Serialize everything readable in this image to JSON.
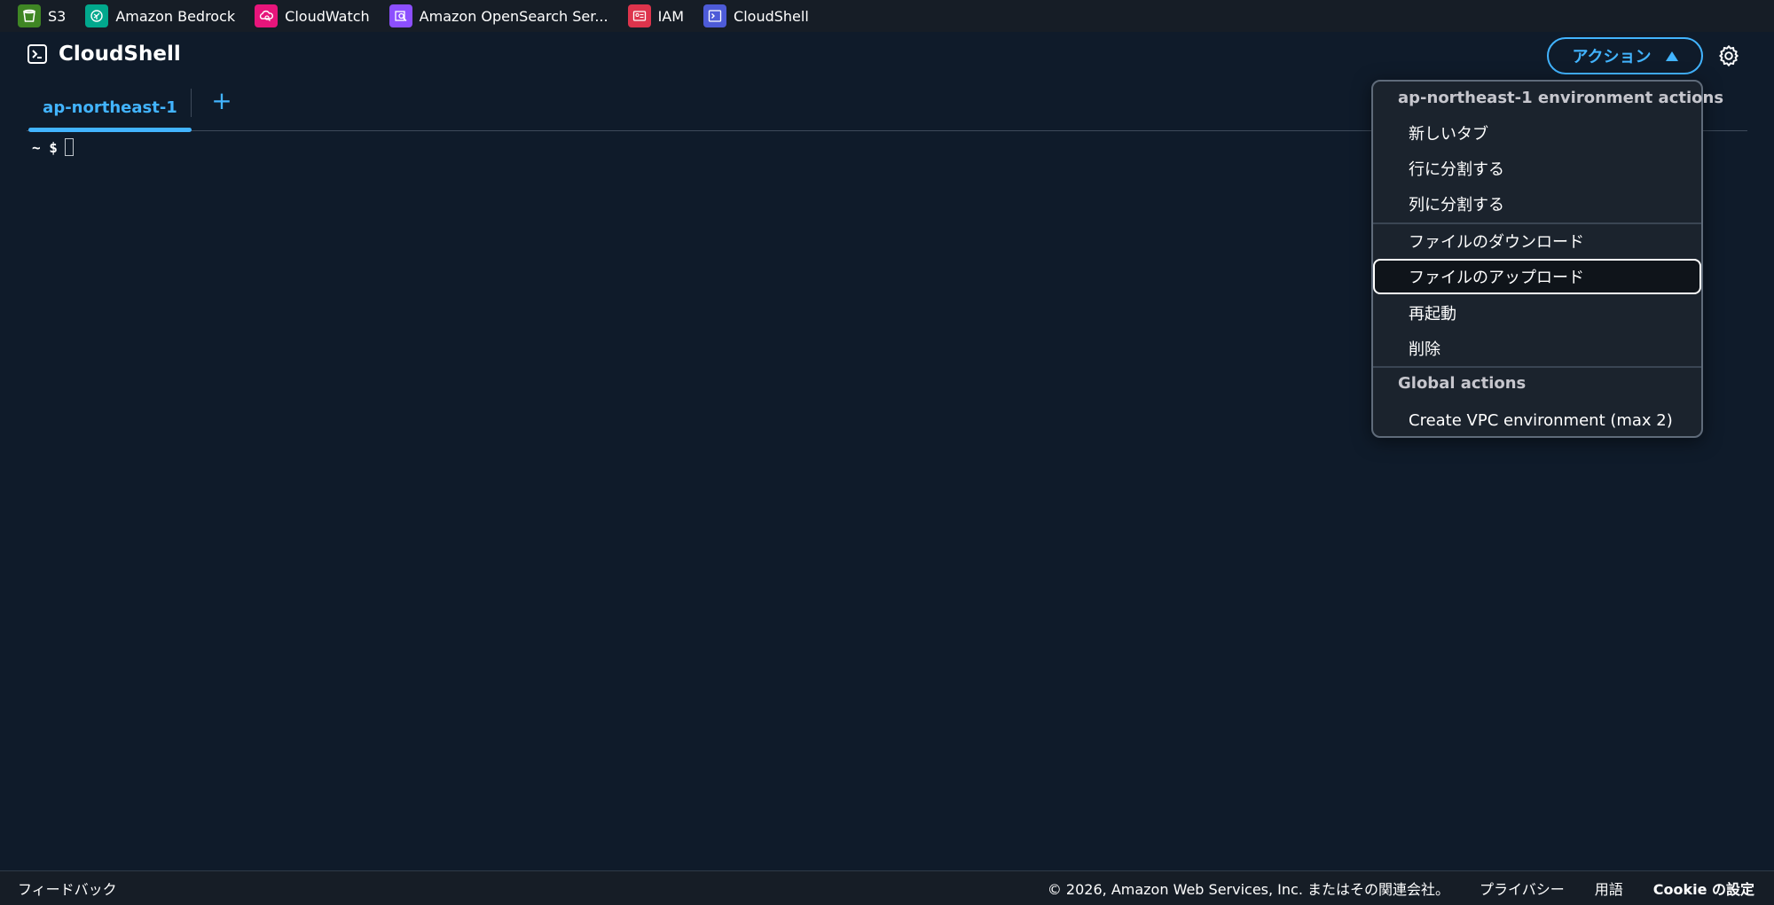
{
  "favorites": [
    {
      "label": "S3",
      "icon": "s3-bucket-icon",
      "color": "#3f8624"
    },
    {
      "label": "Amazon Bedrock",
      "icon": "bedrock-brain-icon",
      "color": "#01a88d"
    },
    {
      "label": "CloudWatch",
      "icon": "cloudwatch-icon",
      "color": "#e7157b"
    },
    {
      "label": "Amazon OpenSearch Ser...",
      "icon": "opensearch-icon",
      "color": "#8c4fff"
    },
    {
      "label": "IAM",
      "icon": "iam-id-card-icon",
      "color": "#dd344c"
    },
    {
      "label": "CloudShell",
      "icon": "cloudshell-terminal-icon",
      "color": "#4d5bd8"
    }
  ],
  "header": {
    "title": "CloudShell",
    "actions_label": "アクション",
    "accent_color": "#42b4ff"
  },
  "tabs": {
    "active": "ap-northeast-1",
    "add_label": "+"
  },
  "terminal": {
    "prompt": "~ $"
  },
  "menu": {
    "env_header": "ap-northeast-1 environment actions",
    "items_group1": [
      "新しいタブ",
      "行に分割する",
      "列に分割する"
    ],
    "items_group2": [
      "ファイルのダウンロード",
      "ファイルのアップロード"
    ],
    "items_group3": [
      "再起動",
      "削除"
    ],
    "global_header": "Global actions",
    "global_items": [
      "Create VPC environment (max 2)"
    ],
    "focused_item": "ファイルのアップロード"
  },
  "footer": {
    "feedback": "フィードバック",
    "copyright": "© 2026, Amazon Web Services, Inc. またはその関連会社。",
    "privacy": "プライバシー",
    "terms": "用語",
    "cookie": "Cookie の設定"
  }
}
